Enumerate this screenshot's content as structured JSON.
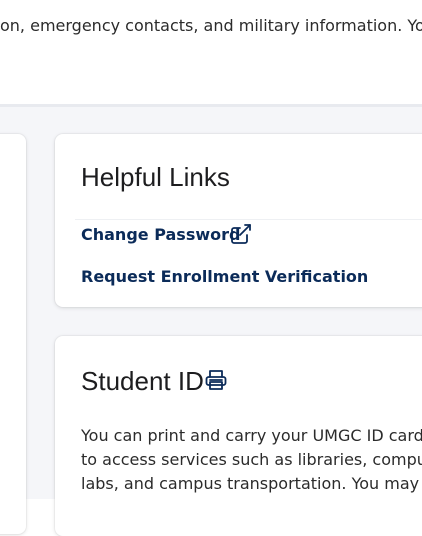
{
  "intro": {
    "text": "on, emergency contacts, and military information. You"
  },
  "helpful_links": {
    "title": "Helpful Links",
    "links": [
      {
        "label": "Change Password",
        "icon": "external-link-icon"
      },
      {
        "label": "Request Enrollment Verification"
      }
    ]
  },
  "student_id": {
    "title": "Student ID",
    "icon": "printer-icon",
    "body_lines": [
      "You can print and carry your UMGC ID card",
      "to access services such as libraries, compute",
      "labs, and campus transportation. You may"
    ]
  },
  "colors": {
    "link": "#0b2b59",
    "page_bg": "#f5f6f9",
    "card_bg": "#ffffff"
  }
}
